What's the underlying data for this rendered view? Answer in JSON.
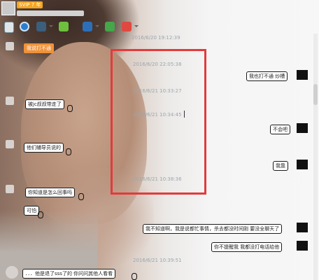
{
  "header": {
    "badge": "SVIP 7",
    "badge_suffix": "年"
  },
  "toolbar": {
    "icons": [
      "paperclip-icon",
      "circle-icon",
      "screen-icon",
      "transfer-icon",
      "monitor-icon",
      "add-contact-icon",
      "apps-icon"
    ]
  },
  "chat": {
    "timestamps": [
      "2016/6/20 19:12:39",
      "2016/6/20 22:05:38",
      "2016/6/21 10:33:27",
      "2016/6/21 10:34:45",
      "2016/6/21 10:38:36",
      "2016/6/21 10:39:51"
    ],
    "left_messages": [
      {
        "text": "我说打不通"
      },
      {
        "text": "被jc叔叔带走了"
      },
      {
        "text": "他们辅导员说的"
      },
      {
        "text": "你知道是怎么回事吗"
      },
      {
        "text": "可怕"
      },
      {
        "text": "．．．他是退了sss了的 你问问其他人看看"
      }
    ],
    "right_messages": [
      {
        "text": "我也打不通 炒槽"
      },
      {
        "text": "不会吧"
      },
      {
        "text": "我靠"
      },
      {
        "text": "我不知道啊，我是说都忙事情，杀去都没时间刚 要没全聊天了"
      },
      {
        "text": "你不提醒我 我都没打电话给他"
      }
    ]
  },
  "colors": {
    "highlight": "#e23b3b",
    "accent_orange": "#f0923a",
    "timestamp": "#9aa6ad"
  }
}
